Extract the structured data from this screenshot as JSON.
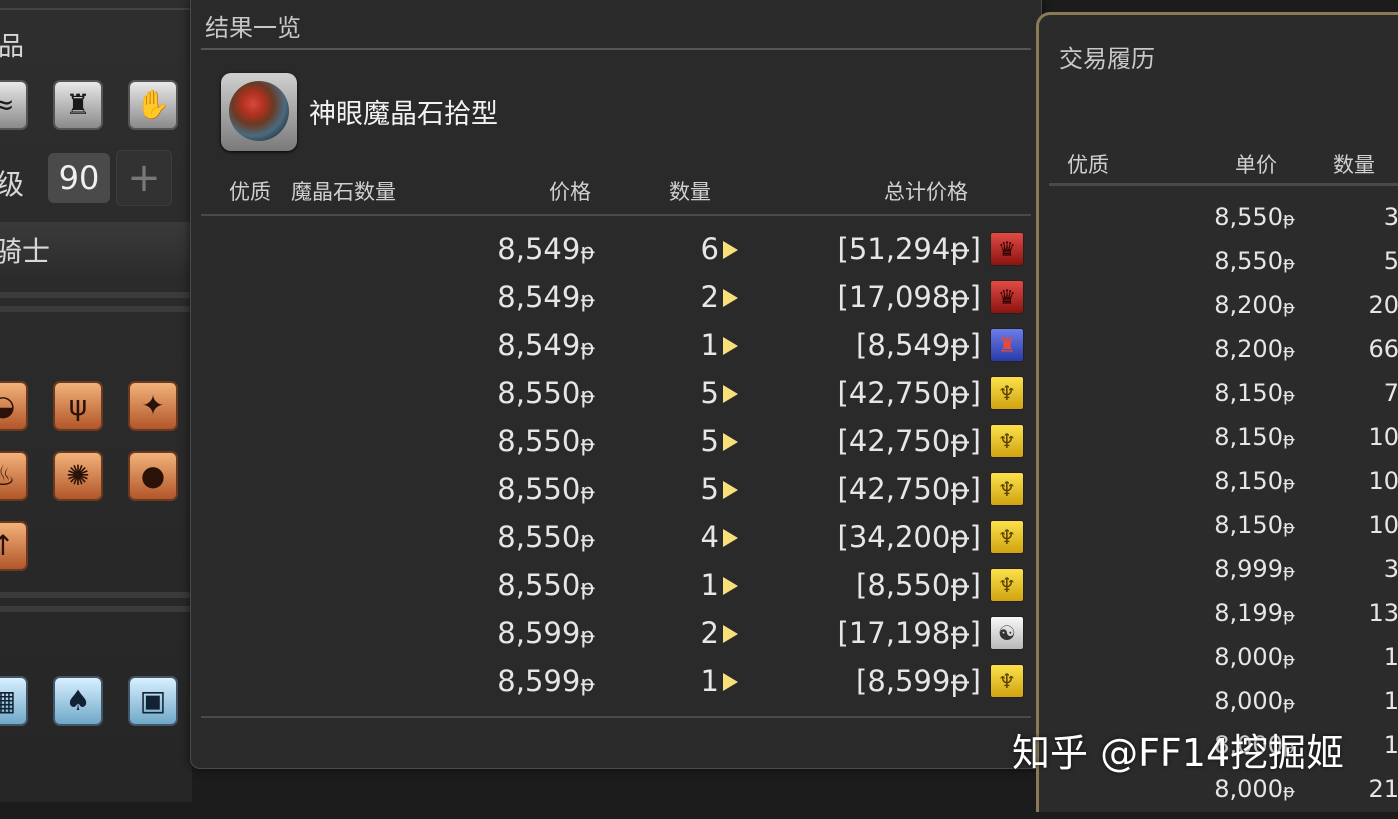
{
  "left_panel": {
    "title_fragment": "品",
    "level_label": "级",
    "level_value": "90",
    "plus_label": "+",
    "job_fragment": "骑士"
  },
  "results": {
    "title": "结果一览",
    "item_name": "神眼魔晶石拾型",
    "headers": {
      "quality": "优质",
      "materia": "魔晶石数量",
      "price": "价格",
      "quantity": "数量",
      "total": "总计价格"
    },
    "currency_glyph": "ᵽ",
    "rows": [
      {
        "price": "8,549",
        "qty": "6",
        "total": "[51,294ᵽ]",
        "retainer": "red"
      },
      {
        "price": "8,549",
        "qty": "2",
        "total": "[17,098ᵽ]",
        "retainer": "red"
      },
      {
        "price": "8,549",
        "qty": "1",
        "total": "[8,549ᵽ]",
        "retainer": "blue"
      },
      {
        "price": "8,550",
        "qty": "5",
        "total": "[42,750ᵽ]",
        "retainer": "yellow"
      },
      {
        "price": "8,550",
        "qty": "5",
        "total": "[42,750ᵽ]",
        "retainer": "yellow"
      },
      {
        "price": "8,550",
        "qty": "5",
        "total": "[42,750ᵽ]",
        "retainer": "yellow"
      },
      {
        "price": "8,550",
        "qty": "4",
        "total": "[34,200ᵽ]",
        "retainer": "yellow"
      },
      {
        "price": "8,550",
        "qty": "1",
        "total": "[8,550ᵽ]",
        "retainer": "yellow"
      },
      {
        "price": "8,599",
        "qty": "2",
        "total": "[17,198ᵽ]",
        "retainer": "white"
      },
      {
        "price": "8,599",
        "qty": "1",
        "total": "[8,599ᵽ]",
        "retainer": "yellow"
      }
    ]
  },
  "history": {
    "title": "交易履历",
    "headers": {
      "quality": "优质",
      "price": "单价",
      "quantity": "数量"
    },
    "rows": [
      {
        "price": "8,550",
        "qty": "3"
      },
      {
        "price": "8,550",
        "qty": "5"
      },
      {
        "price": "8,200",
        "qty": "20"
      },
      {
        "price": "8,200",
        "qty": "66"
      },
      {
        "price": "8,150",
        "qty": "7"
      },
      {
        "price": "8,150",
        "qty": "10"
      },
      {
        "price": "8,150",
        "qty": "10"
      },
      {
        "price": "8,150",
        "qty": "10"
      },
      {
        "price": "8,999",
        "qty": "3"
      },
      {
        "price": "8,199",
        "qty": "13"
      },
      {
        "price": "8,000",
        "qty": "1"
      },
      {
        "price": "8,000",
        "qty": "1"
      },
      {
        "price": "8,000",
        "qty": "1"
      },
      {
        "price": "8,000",
        "qty": "21"
      }
    ]
  },
  "watermark": "知乎 @FF14挖掘姬",
  "colors": {
    "arrow": "#f6e07a",
    "history_border": "#8a7a58"
  }
}
